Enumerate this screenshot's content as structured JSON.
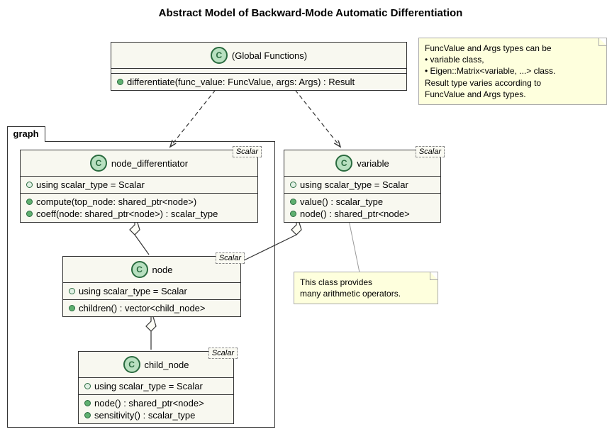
{
  "title": "Abstract Model of Backward-Mode Automatic Differentiation",
  "package": {
    "name": "graph"
  },
  "classes": {
    "global": {
      "name": "(Global Functions)",
      "methods": [
        "differentiate(func_value: FuncValue, args: Args) : Result"
      ]
    },
    "node_differentiator": {
      "name": "node_differentiator",
      "template": "Scalar",
      "typedefs": [
        "using scalar_type = Scalar"
      ],
      "methods": [
        "compute(top_node: shared_ptr<node>)",
        "coeff(node: shared_ptr<node>) : scalar_type"
      ]
    },
    "variable": {
      "name": "variable",
      "template": "Scalar",
      "typedefs": [
        "using scalar_type = Scalar"
      ],
      "methods": [
        "value() : scalar_type",
        "node() : shared_ptr<node>"
      ]
    },
    "node": {
      "name": "node",
      "template": "Scalar",
      "typedefs": [
        "using scalar_type = Scalar"
      ],
      "methods": [
        "children() : vector<child_node>"
      ]
    },
    "child_node": {
      "name": "child_node",
      "template": "Scalar",
      "typedefs": [
        "using scalar_type = Scalar"
      ],
      "methods": [
        "node() : shared_ptr<node>",
        "sensitivity() : scalar_type"
      ]
    }
  },
  "notes": {
    "global_note": {
      "lines": [
        "FuncValue and Args types can be",
        " • variable class,",
        " • Eigen::Matrix<variable, ...> class.",
        "Result type varies according to",
        "FuncValue and Args types."
      ]
    },
    "variable_note": {
      "lines": [
        "This class provides",
        "many arithmetic operators."
      ]
    }
  },
  "icons": {
    "class_letter": "C"
  }
}
